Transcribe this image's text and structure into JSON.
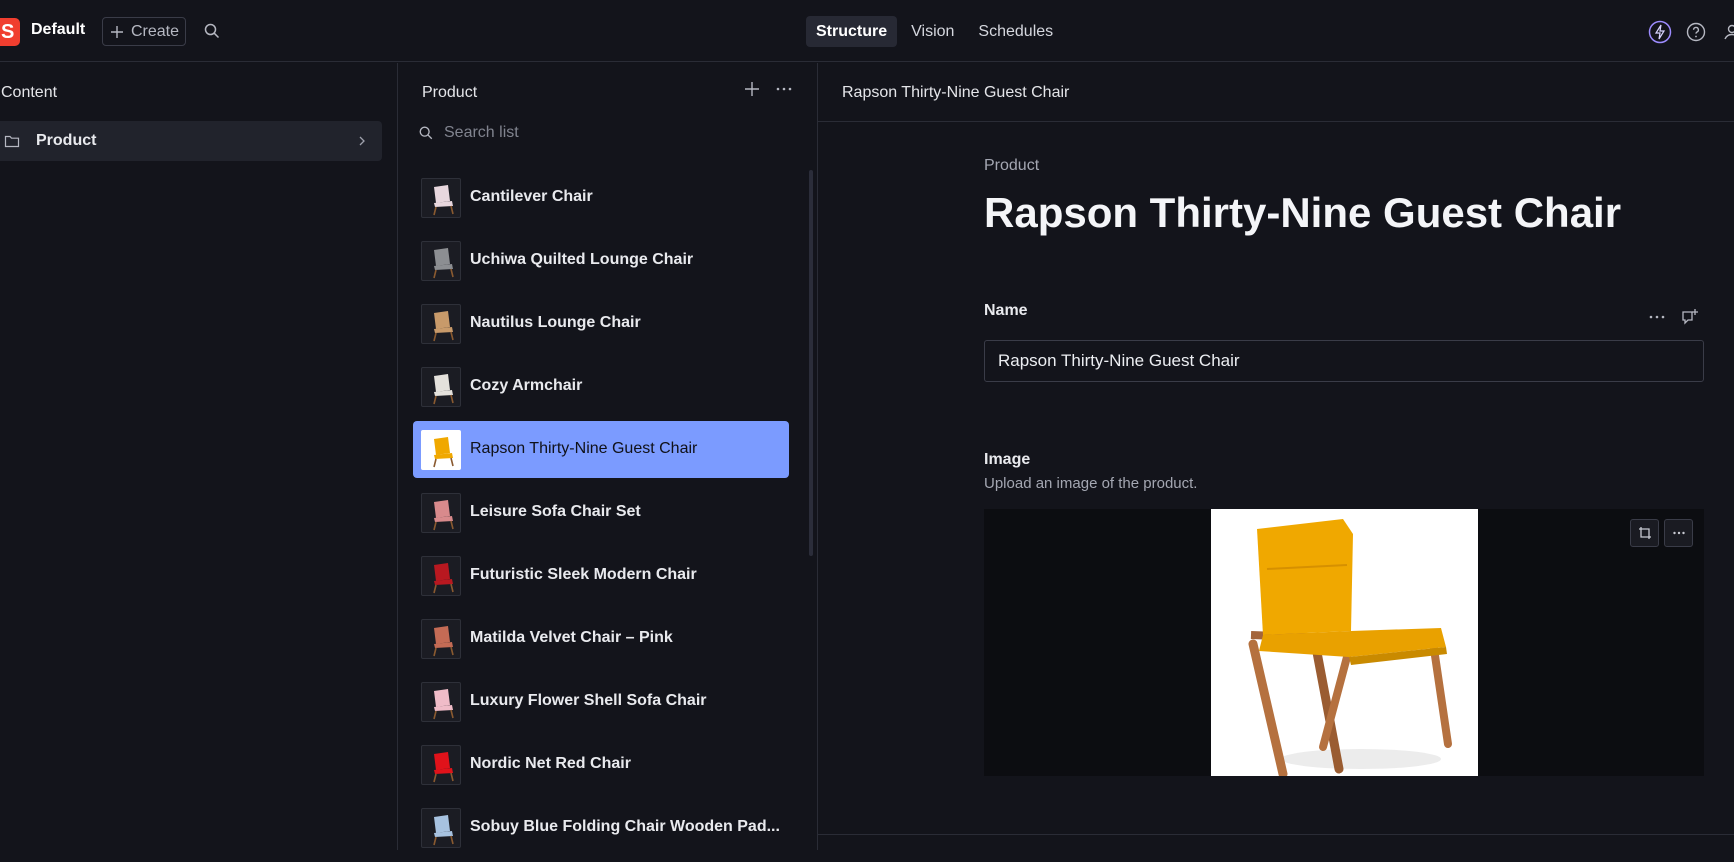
{
  "topbar": {
    "logo_letter": "S",
    "workspace": "Default",
    "create_label": "Create",
    "tabs": [
      {
        "label": "Structure",
        "active": true
      },
      {
        "label": "Vision",
        "active": false
      },
      {
        "label": "Schedules",
        "active": false
      }
    ],
    "right_icons": [
      "bolt-icon",
      "help-icon",
      "user-icon"
    ]
  },
  "content_pane": {
    "title": "Content",
    "items": [
      {
        "label": "Product",
        "icon": "folder-icon"
      }
    ]
  },
  "product_pane": {
    "title": "Product",
    "search_placeholder": "Search list",
    "items": [
      {
        "label": "Cantilever Chair",
        "selected": false,
        "thumb_color": "#e8d7de"
      },
      {
        "label": "Uchiwa Quilted Lounge Chair",
        "selected": false,
        "thumb_color": "#8c8e92"
      },
      {
        "label": "Nautilus Lounge Chair",
        "selected": false,
        "thumb_color": "#c89a6a"
      },
      {
        "label": "Cozy Armchair",
        "selected": false,
        "thumb_color": "#e4e1dc"
      },
      {
        "label": "Rapson Thirty-Nine Guest Chair",
        "selected": true,
        "thumb_color": "#f0a800"
      },
      {
        "label": "Leisure Sofa Chair Set",
        "selected": false,
        "thumb_color": "#d88a8c"
      },
      {
        "label": "Futuristic Sleek Modern Chair",
        "selected": false,
        "thumb_color": "#b81820"
      },
      {
        "label": "Matilda Velvet Chair – Pink",
        "selected": false,
        "thumb_color": "#c46b55"
      },
      {
        "label": "Luxury Flower Shell Sofa Chair",
        "selected": false,
        "thumb_color": "#f0bcc8"
      },
      {
        "label": "Nordic Net Red Chair",
        "selected": false,
        "thumb_color": "#e0121a"
      },
      {
        "label": "Sobuy Blue Folding Chair Wooden Pad...",
        "selected": false,
        "thumb_color": "#a7c2e0"
      }
    ]
  },
  "document": {
    "header_title": "Rapson Thirty-Nine Guest Chair",
    "type": "Product",
    "title": "Rapson Thirty-Nine Guest Chair",
    "name_field": {
      "label": "Name",
      "value": "Rapson Thirty-Nine Guest Chair"
    },
    "image_field": {
      "label": "Image",
      "description": "Upload an image of the product."
    }
  },
  "colors": {
    "accent": "#7b9bff",
    "brand": "#f03e2f",
    "chair_yellow": "#f0a800",
    "wood": "#b5713f"
  }
}
